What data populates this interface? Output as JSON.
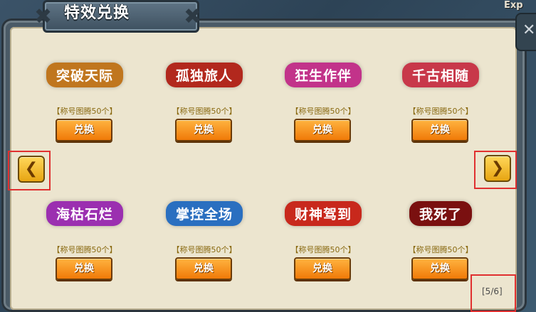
{
  "window": {
    "title": "特效兑换",
    "exp_label": "Exp",
    "close_symbol": "✕"
  },
  "items": [
    {
      "name": "突破天际",
      "label": "【称号图腾50个】",
      "button": "兑换",
      "color": "#c0761e"
    },
    {
      "name": "孤独旅人",
      "label": "【称号图腾50个】",
      "button": "兑换",
      "color": "#b2281d"
    },
    {
      "name": "狂生作伴",
      "label": "【称号图腾50个】",
      "button": "兑换",
      "color": "#c2338a"
    },
    {
      "name": "千古相随",
      "label": "【称号图腾50个】",
      "button": "兑换",
      "color": "#c8384a"
    },
    {
      "name": "海枯石烂",
      "label": "【称号图腾50个】",
      "button": "兑换",
      "color": "#9b2fb0"
    },
    {
      "name": "掌控全场",
      "label": "【称号图腾50个】",
      "button": "兑换",
      "color": "#2a6fc0"
    },
    {
      "name": "财神驾到",
      "label": "【称号图腾50个】",
      "button": "兑换",
      "color": "#c8281c"
    },
    {
      "name": "我死了",
      "label": "【称号图腾50个】",
      "button": "兑换",
      "color": "#7a1010"
    }
  ],
  "navigation": {
    "prev_symbol": "❮",
    "next_symbol": "❯",
    "page_indicator": "[5/6]"
  }
}
